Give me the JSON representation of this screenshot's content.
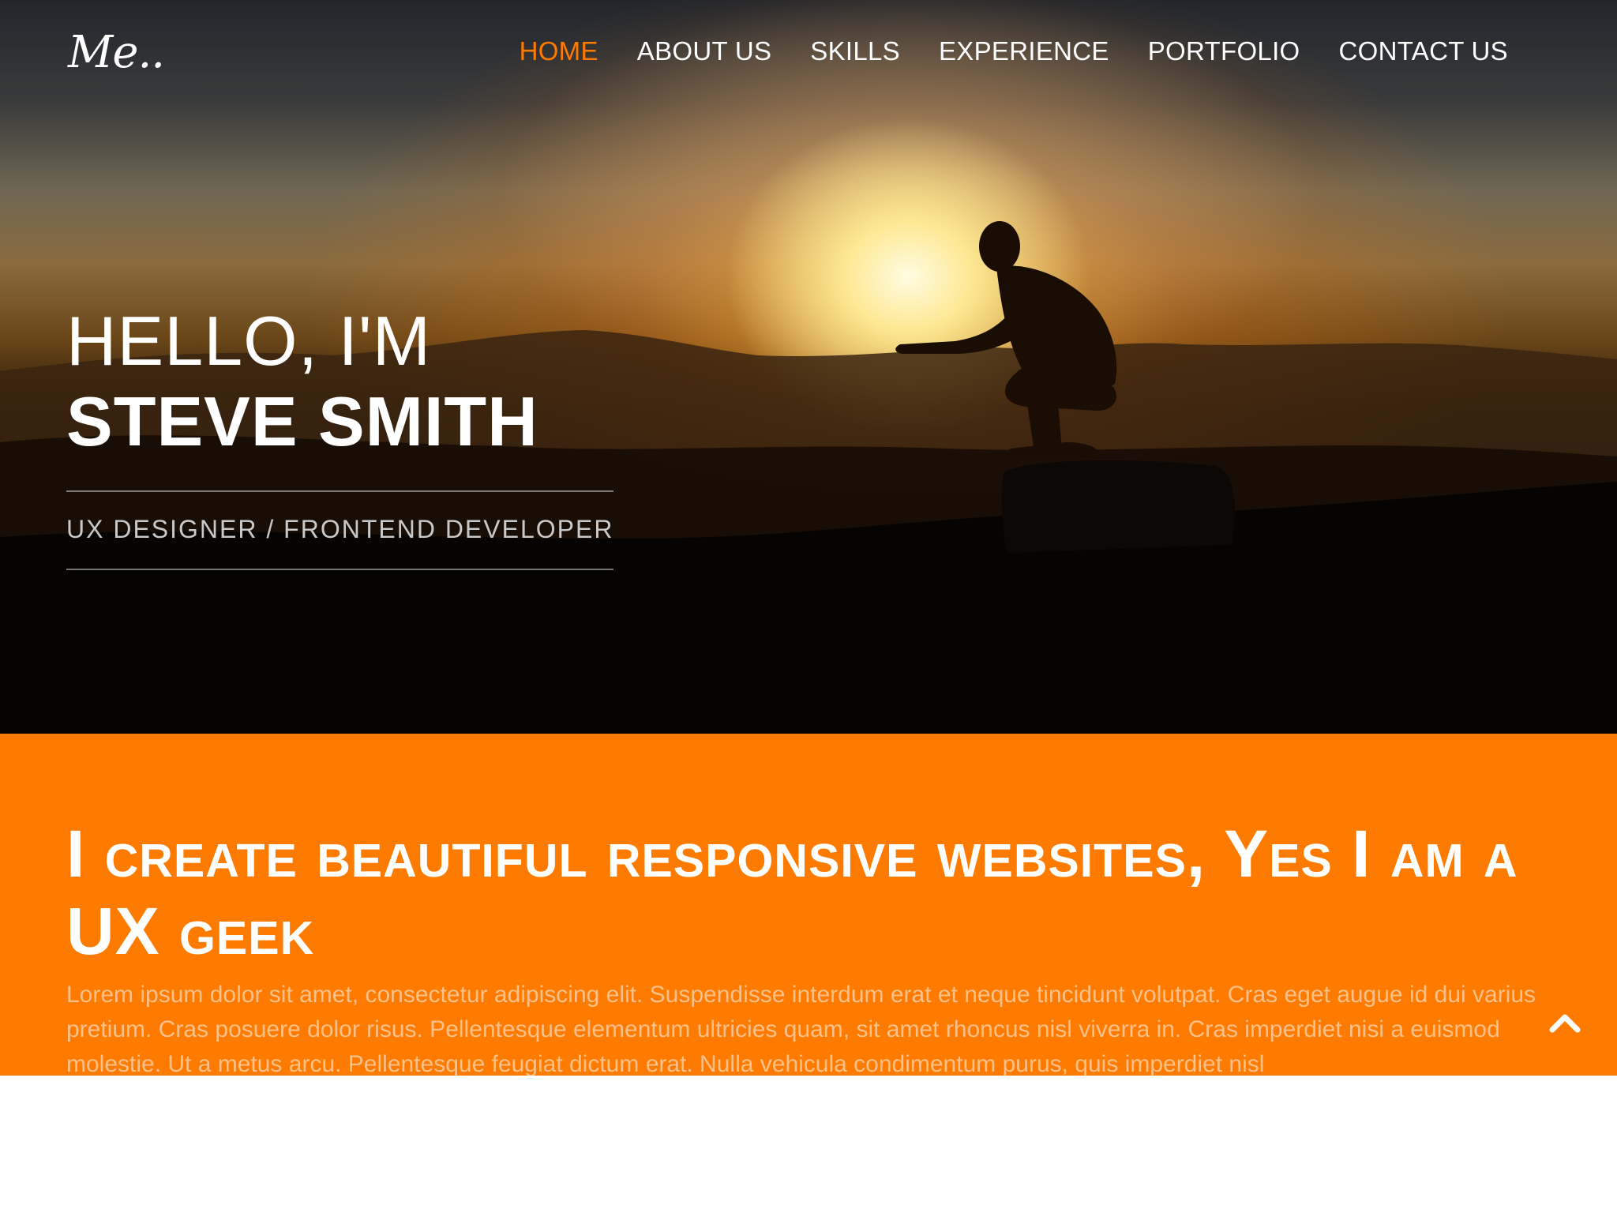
{
  "brand": {
    "logo": "Me.."
  },
  "nav": {
    "items": [
      {
        "label": "HOME",
        "active": true
      },
      {
        "label": "ABOUT US",
        "active": false
      },
      {
        "label": "SKILLS",
        "active": false
      },
      {
        "label": "EXPERIENCE",
        "active": false
      },
      {
        "label": "PORTFOLIO",
        "active": false
      },
      {
        "label": "CONTACT US",
        "active": false
      }
    ]
  },
  "hero": {
    "greeting": "HELLO, I'M",
    "name": "STEVE SMITH",
    "role": "UX DESIGNER / FRONTEND DEVELOPER"
  },
  "intro": {
    "headline": "I create beautiful responsive websites, Yes I am a UX geek",
    "body": "Lorem ipsum dolor sit amet, consectetur adipiscing elit. Suspendisse interdum erat et neque tincidunt volutpat. Cras eget augue id dui varius pretium. Cras posuere dolor risus. Pellentesque elementum ultricies quam, sit amet rhoncus nisl viverra in. Cras imperdiet nisi a euismod molestie. Ut a metus arcu. Pellentesque feugiat dictum erat. Nulla vehicula condimentum purus, quis imperdiet nisl"
  },
  "colors": {
    "accent": "#ff7b00",
    "body_text_on_accent": "#ffc189",
    "text_light": "#ffffff"
  },
  "icons": {
    "back_to_top": "chevron-up-icon"
  }
}
